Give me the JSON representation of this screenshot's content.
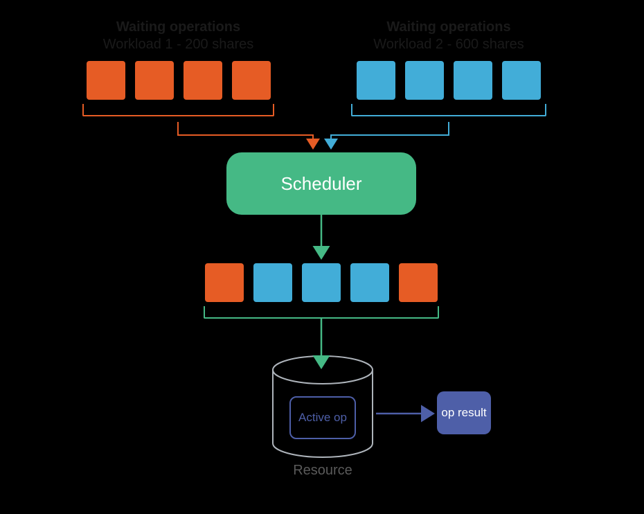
{
  "workload1": {
    "title": "Waiting operations",
    "subtitle": "Workload 1 - 200 shares",
    "color": "#e65c25",
    "boxCount": 4
  },
  "workload2": {
    "title": "Waiting operations",
    "subtitle": "Workload 2 - 600 shares",
    "color": "#42add8",
    "boxCount": 4
  },
  "scheduler": {
    "label": "Scheduler",
    "color": "#45b985"
  },
  "scheduledQueue": {
    "bracketColor": "#45b985",
    "items": [
      "orange",
      "blue",
      "blue",
      "blue",
      "orange"
    ]
  },
  "resource": {
    "label": "Resource",
    "activeOpLabel": "Active op",
    "opResultLabel": "op result",
    "boxColor": "#4e5fa8",
    "outlineColor": "#aeb4bb"
  }
}
